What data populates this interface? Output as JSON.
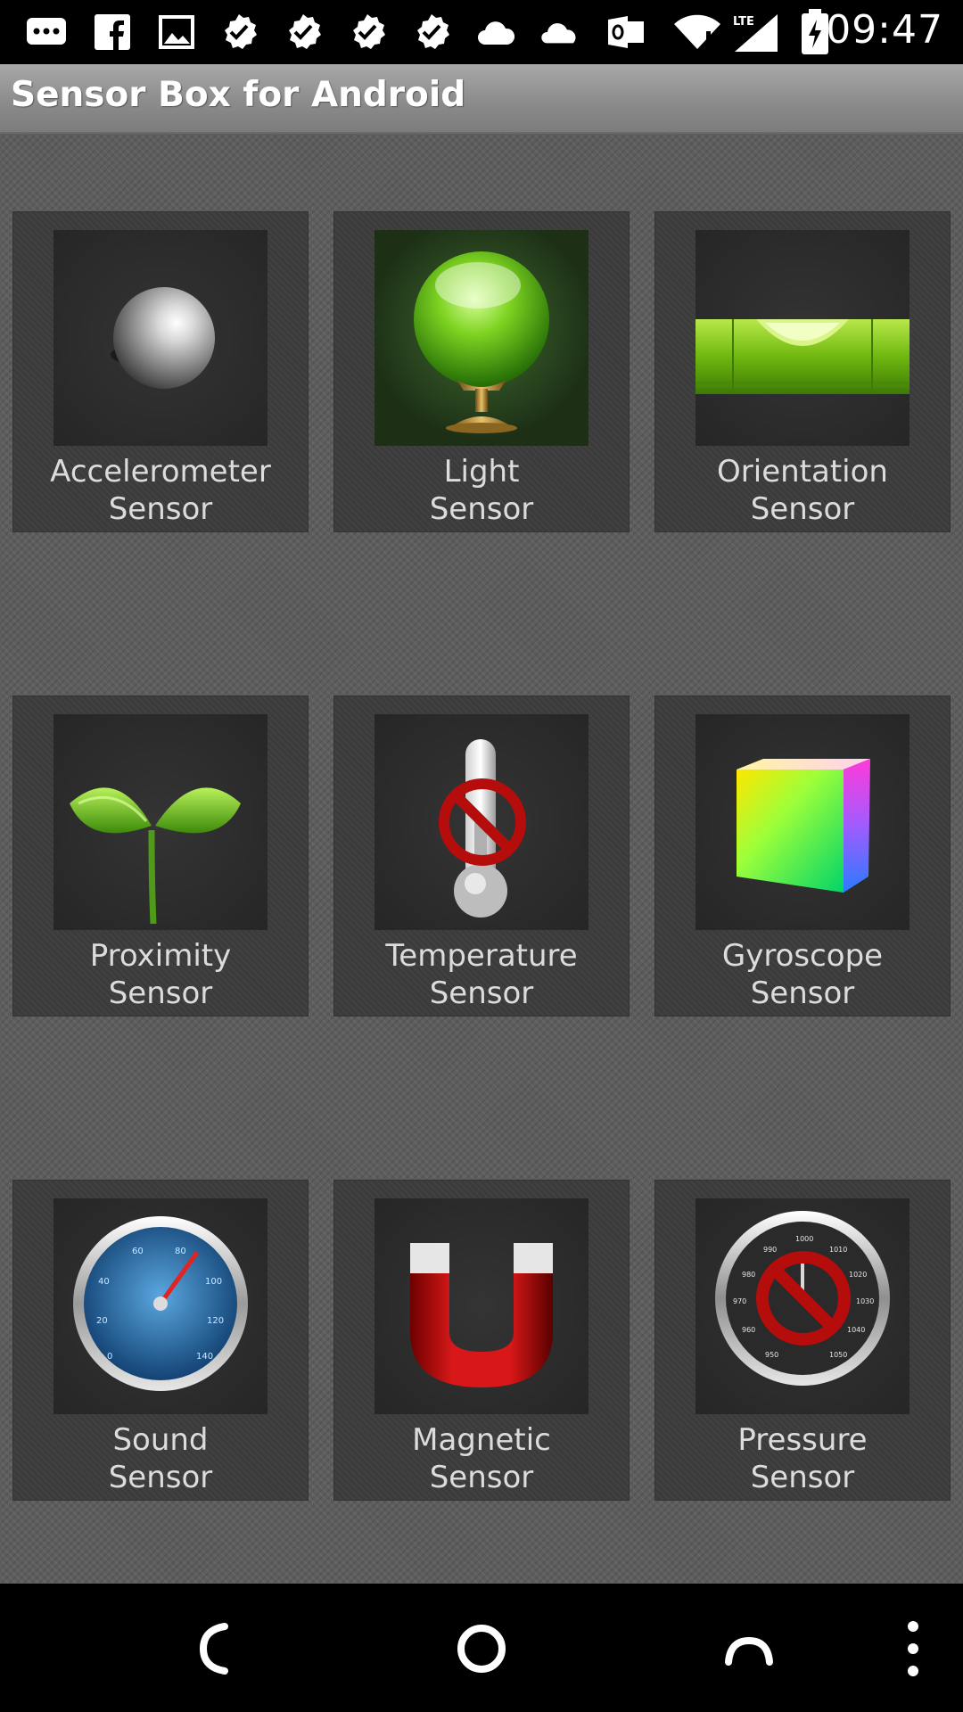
{
  "status_bar": {
    "time": "09:47",
    "icons": [
      "chat-icon",
      "facebook-icon",
      "image-icon",
      "check-icon",
      "check-icon",
      "check-icon",
      "check-icon",
      "cloud-icon",
      "cloud-icon",
      "outlook-icon",
      "wifi-icon",
      "lte-signal-icon",
      "battery-charging-icon"
    ],
    "network": "LTE"
  },
  "app": {
    "title": "Sensor Box for Android"
  },
  "sensors": [
    {
      "line1": "Accelerometer",
      "line2": "Sensor",
      "icon": "metal-ball-icon",
      "available": true
    },
    {
      "line1": "Light",
      "line2": "Sensor",
      "icon": "crystal-ball-icon",
      "available": true
    },
    {
      "line1": "Orientation",
      "line2": "Sensor",
      "icon": "spirit-level-icon",
      "available": true
    },
    {
      "line1": "Proximity",
      "line2": "Sensor",
      "icon": "sprout-icon",
      "available": true
    },
    {
      "line1": "Temperature",
      "line2": "Sensor",
      "icon": "thermometer-icon",
      "available": false
    },
    {
      "line1": "Gyroscope",
      "line2": "Sensor",
      "icon": "color-cube-icon",
      "available": true
    },
    {
      "line1": "Sound",
      "line2": "Sensor",
      "icon": "speedometer-icon",
      "available": true
    },
    {
      "line1": "Magnetic",
      "line2": "Sensor",
      "icon": "magnet-icon",
      "available": true
    },
    {
      "line1": "Pressure",
      "line2": "Sensor",
      "icon": "barometer-icon",
      "available": false
    }
  ],
  "gauge_labels": {
    "sound": [
      "0",
      "20",
      "40",
      "60",
      "80",
      "100",
      "120",
      "140"
    ],
    "pressure": [
      "950",
      "960",
      "970",
      "980",
      "990",
      "1000",
      "1010",
      "1020",
      "1030",
      "1040",
      "1050"
    ]
  },
  "nav_bar": [
    "back-icon",
    "home-icon",
    "recents-icon",
    "overflow-menu-icon"
  ],
  "colors": {
    "status_bar": "#000000",
    "title_bar": "#9a9a9a",
    "title_text": "#ffffff",
    "tile_label": "#dcdcdc",
    "prohibited": "#b50c0c"
  }
}
